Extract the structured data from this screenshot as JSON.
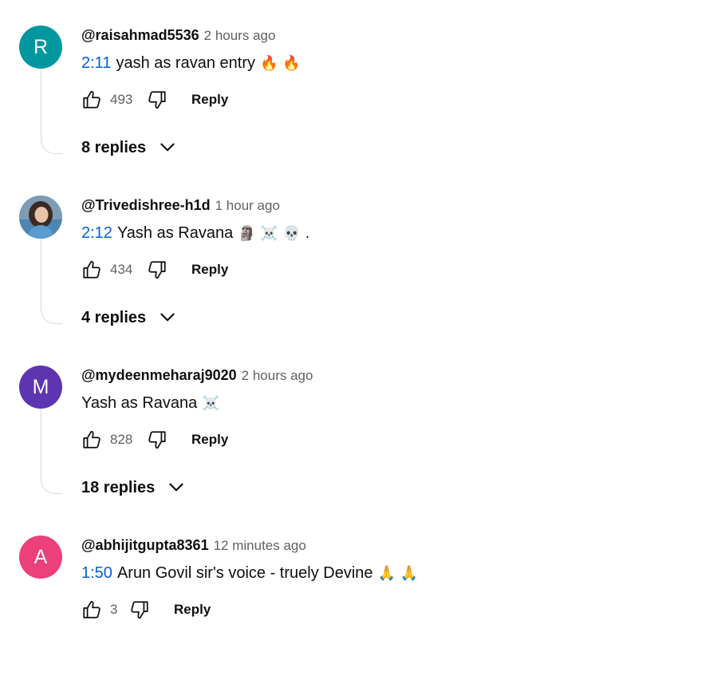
{
  "comments": [
    {
      "avatar_letter": "R",
      "avatar_color": "#00979e",
      "author": "@raisahmad5536",
      "time": "2 hours ago",
      "timestamp": "2:11",
      "text": "yash as ravan entry",
      "emoji": "🔥 🔥",
      "likes": "493",
      "reply_label": "Reply",
      "replies_label": "8 replies"
    },
    {
      "avatar_letter": "",
      "avatar_color": "#9fb6c9",
      "author": "@Trivedishree-h1d",
      "time": "1 hour ago",
      "timestamp": "2:12",
      "text": "Yash as Ravana",
      "emoji": "🗿 ☠️ 💀 .",
      "likes": "434",
      "reply_label": "Reply",
      "replies_label": "4 replies"
    },
    {
      "avatar_letter": "M",
      "avatar_color": "#5e35b1",
      "author": "@mydeenmeharaj9020",
      "time": "2 hours ago",
      "timestamp": "",
      "text": "Yash as Ravana",
      "emoji": "☠️",
      "likes": "828",
      "reply_label": "Reply",
      "replies_label": "18 replies"
    },
    {
      "avatar_letter": "A",
      "avatar_color": "#ec407a",
      "author": "@abhijitgupta8361",
      "time": "12 minutes ago",
      "timestamp": "1:50",
      "text": "Arun Govil sir's voice - truely Devine",
      "emoji": "🙏 🙏",
      "likes": "3",
      "reply_label": "Reply",
      "replies_label": ""
    }
  ],
  "icons": {
    "like": "thumbs-up-outline",
    "dislike": "thumbs-down-outline",
    "expand": "chevron-down"
  },
  "colors": {
    "link": "#065fd4",
    "secondary_text": "#606060",
    "thread_line": "#d9d9d9"
  }
}
